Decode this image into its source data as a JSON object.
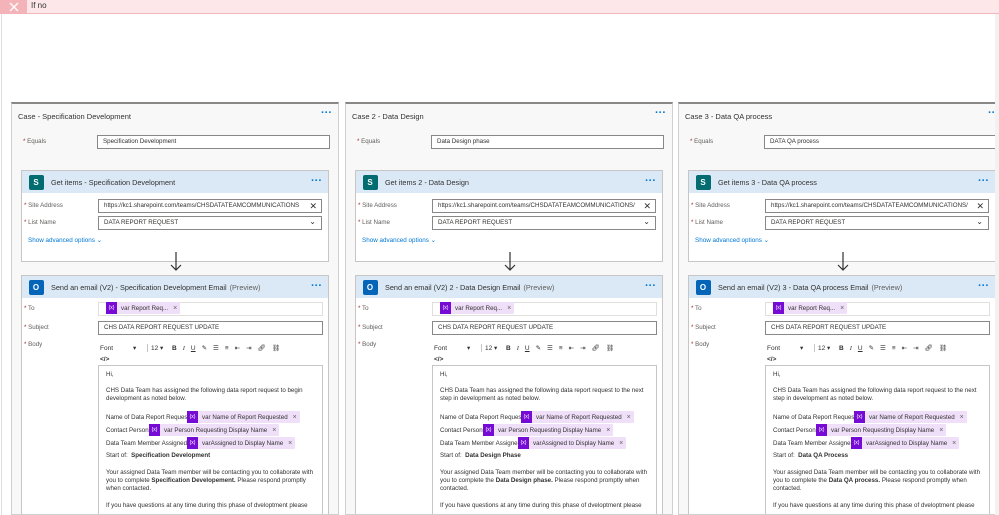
{
  "if_no": {
    "label": "If no"
  },
  "cases": [
    {
      "title": "Case - Specification Development",
      "equals_label": "Equals",
      "equals_value": "Specification Development",
      "get_items": {
        "title": "Get items - Specification Development",
        "site_label": "Site Address",
        "site_value": "https://kc1.sharepoint.com/teams/CHSDATATEAMCOMMUNICATIONS",
        "list_label": "List Name",
        "list_value": "DATA REPORT REQUEST",
        "advanced": "Show advanced options"
      },
      "email": {
        "title": "Send an email (V2) - Specification Development Email",
        "preview": "(Preview)",
        "to_label": "To",
        "to_token": "var Report Req...",
        "subject_label": "Subject",
        "subject_value": "CHS DATA REPORT REQUEST UPDATE",
        "body_label": "Body",
        "font": "Font",
        "size": "12",
        "greeting": "Hi,",
        "para1_line1": "CHS Data Team has assigned the following data report request to begin",
        "para1_line2": "development as noted below.",
        "name_label": "Name of Data Report Request:",
        "name_token": "var Name of Report Requested",
        "contact_label": "Contact Person:",
        "contact_token": "var Person Requesting Display Name",
        "member_label": "Data Team Member Assigned:",
        "member_token": "varAssigned to Display Name",
        "start_label": "Start of:",
        "start_value": "Specification Development",
        "para2_line1": "Your assigned Data Team member will be contacting you to collaborate with",
        "para2_line2_pre": "you to complete ",
        "para2_line2_bold": "Specification Developement.",
        "para2_line2_post": "  Please respond promptly",
        "para2_line3": "when contacted.",
        "para3_line1": "If you have questions at any time during this phase of dveloptment please"
      }
    },
    {
      "title": "Case 2 - Data Design",
      "equals_label": "Equals",
      "equals_value": "Data Design phase",
      "get_items": {
        "title": "Get items 2 - Data Design",
        "site_label": "Site Address",
        "site_value": "https://kc1.sharepoint.com/teams/CHSDATATEAMCOMMUNICATIONS/",
        "list_label": "List Name",
        "list_value": "DATA REPORT REQUEST",
        "advanced": "Show advanced options"
      },
      "email": {
        "title": "Send an email (V2) 2 - Data Design Email",
        "preview": "(Preview)",
        "to_label": "To",
        "to_token": "var Report Req...",
        "subject_label": "Subject",
        "subject_value": "CHS DATA REPORT REQUEST UPDATE",
        "body_label": "Body",
        "font": "Font",
        "size": "12",
        "greeting": "Hi,",
        "para1_line1": "CHS Data Team has assigned the following data report request to the next",
        "para1_line2": "step in development as noted below.",
        "name_label": "Name of Data Report Request:",
        "name_token": "var Name of Report Requested",
        "contact_label": "Contact Person:",
        "contact_token": "var Person Requesting Display Name",
        "member_label": "Data Team Member Assigned:",
        "member_token": "varAssigned to Display Name",
        "start_label": "Start of:",
        "start_value": "Data Design Phase",
        "para2_line1": "Your assigned Data Team member will be contacting you to collaborate with",
        "para2_line2_pre": "you to complete the ",
        "para2_line2_bold": "Data Design phase.",
        "para2_line2_post": "  Please respond promptly when",
        "para2_line3": "contacted.",
        "para3_line1": "If you have questions at any time during this phase of dveloptment please"
      }
    },
    {
      "title": "Case 3 - Data QA process",
      "equals_label": "Equals",
      "equals_value": "DATA QA process",
      "get_items": {
        "title": "Get items 3 - Data QA process",
        "site_label": "Site Address",
        "site_value": "https://kc1.sharepoint.com/teams/CHSDATATEAMCOMMUNICATIONS/",
        "list_label": "List Name",
        "list_value": "DATA REPORT REQUEST",
        "advanced": "Show advanced options"
      },
      "email": {
        "title": "Send an email (V2) 3 - Data QA process Email",
        "preview": "(Preview)",
        "to_label": "To",
        "to_token": "var Report Req...",
        "subject_label": "Subject",
        "subject_value": "CHS DATA REPORT REQUEST UPDATE",
        "body_label": "Body",
        "font": "Font",
        "size": "12",
        "greeting": "Hi,",
        "para1_line1": "CHS Data Team has assigned the following data report request to the next",
        "para1_line2": "step in development as noted below.",
        "name_label": "Name of Data Report Request:",
        "name_token": "var Name of Report Requested",
        "contact_label": "Contact Person:",
        "contact_token": "var Person Requesting Display Name",
        "member_label": "Data Team Member Assigned:",
        "member_token": "varAssigned to Display Name",
        "start_label": "Start of:",
        "start_value": "Data QA Process",
        "para2_line1": "Your assigned Data Team member will be contacting you to collaborate with",
        "para2_line2_pre": "you to complete the ",
        "para2_line2_bold": "Data QA process.",
        "para2_line2_post": "  Please respond promptly when",
        "para2_line3": "contacted.",
        "para3_line1": "If you have questions at any time during this phase of dveloptment please"
      }
    }
  ],
  "colors": {
    "accent": "#0078d4",
    "card_header": "#dbe9f6",
    "token_bg": "#efdff9",
    "token_icon": "#770bd6",
    "if_no_band": "#fde7e9",
    "sharepoint": "#036c70",
    "outlook": "#0364b8"
  }
}
